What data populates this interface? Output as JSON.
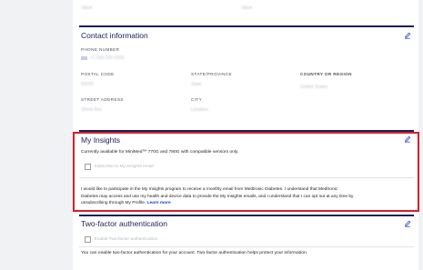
{
  "top_section": {
    "value_left": "Value",
    "value_right": "Value"
  },
  "contact": {
    "title": "Contact information",
    "phone_label": "PHONE NUMBER",
    "phone_value": "+1 555 000 0000",
    "postal_label": "POSTAL CODE",
    "postal_value": "00000",
    "state_label": "STATE/PROVINCE",
    "state_value": "State",
    "country_label": "COUNTRY OR REGION",
    "country_value": "United States",
    "street_label": "STREET ADDRESS",
    "street_value": "Street Ave",
    "city_label": "CITY",
    "city_value": "Location"
  },
  "insights": {
    "title": "My Insights",
    "availability": "Currently available for MiniMed™ 770G and 780G with compatible sensors only.",
    "subscribe_label": "Subscribe to My Insights email",
    "consent_text": "I would like to participate in the My Insights program to receive a monthly email from Medtronic Diabetes. I understand that Medtronic Diabetes may access and use my health and device data to provide the My Insights emails, and I understand that I can opt out at any time by unsubscribing through My Profile.",
    "learn_more": "Learn more"
  },
  "two_factor": {
    "title": "Two-factor authentication",
    "enable_label": "Enable Two-factor authentication",
    "description": "You can enable two-factor authentication for your account. Two-factor authentication helps protect your information."
  },
  "colors": {
    "accent": "#1a1f5e",
    "highlight": "#d71f2a",
    "link": "#1a3ec9"
  }
}
